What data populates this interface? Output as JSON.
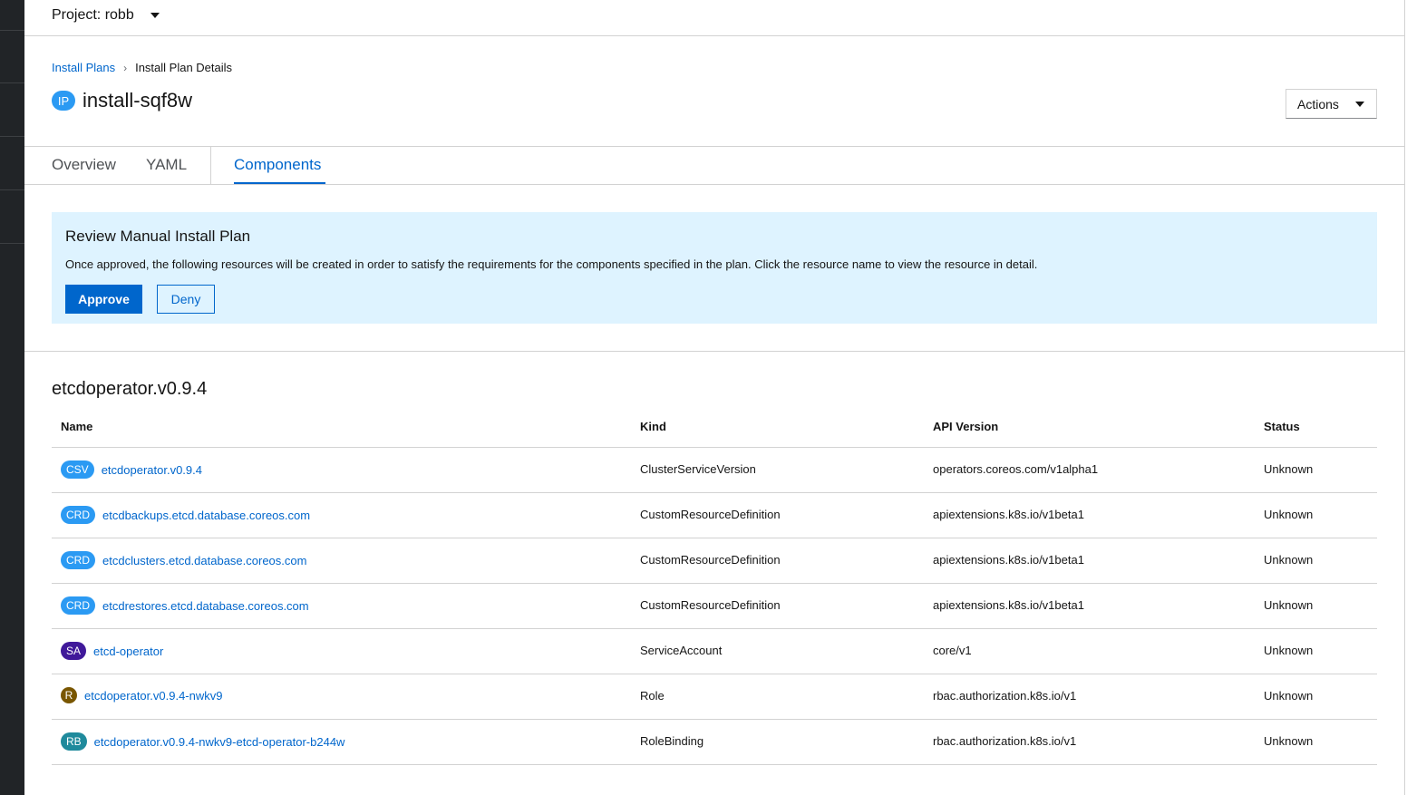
{
  "project": {
    "label": "Project: robb"
  },
  "breadcrumb": {
    "parent": "Install Plans",
    "current": "Install Plan Details"
  },
  "header": {
    "badge": "IP",
    "title": "install-sqf8w",
    "actions_label": "Actions"
  },
  "tabs": [
    {
      "label": "Overview"
    },
    {
      "label": "YAML"
    },
    {
      "label": "Components"
    }
  ],
  "alert": {
    "title": "Review Manual Install Plan",
    "text": "Once approved, the following resources will be created in order to satisfy the requirements for the components specified in the plan. Click the resource name to view the resource in detail.",
    "approve_label": "Approve",
    "deny_label": "Deny"
  },
  "section": {
    "title": "etcdoperator.v0.9.4"
  },
  "table": {
    "headers": {
      "name": "Name",
      "kind": "Kind",
      "api": "API Version",
      "status": "Status"
    },
    "rows": [
      {
        "badge": "CSV",
        "name": "etcdoperator.v0.9.4",
        "kind": "ClusterServiceVersion",
        "api": "operators.coreos.com/v1alpha1",
        "status": "Unknown"
      },
      {
        "badge": "CRD",
        "name": "etcdbackups.etcd.database.coreos.com",
        "kind": "CustomResourceDefinition",
        "api": "apiextensions.k8s.io/v1beta1",
        "status": "Unknown"
      },
      {
        "badge": "CRD",
        "name": "etcdclusters.etcd.database.coreos.com",
        "kind": "CustomResourceDefinition",
        "api": "apiextensions.k8s.io/v1beta1",
        "status": "Unknown"
      },
      {
        "badge": "CRD",
        "name": "etcdrestores.etcd.database.coreos.com",
        "kind": "CustomResourceDefinition",
        "api": "apiextensions.k8s.io/v1beta1",
        "status": "Unknown"
      },
      {
        "badge": "SA",
        "name": "etcd-operator",
        "kind": "ServiceAccount",
        "api": "core/v1",
        "status": "Unknown"
      },
      {
        "badge": "R",
        "name": "etcdoperator.v0.9.4-nwkv9",
        "kind": "Role",
        "api": "rbac.authorization.k8s.io/v1",
        "status": "Unknown"
      },
      {
        "badge": "RB",
        "name": "etcdoperator.v0.9.4-nwkv9-etcd-operator-b244w",
        "kind": "RoleBinding",
        "api": "rbac.authorization.k8s.io/v1",
        "status": "Unknown"
      }
    ]
  },
  "colors": {
    "link": "#0066cc",
    "alert_bg": "#def3ff",
    "nav_bg": "#212427",
    "badge_blue": "#2b9af3",
    "badge_sa": "#40199a",
    "badge_role": "#795600",
    "badge_rolebinding": "#1f8a9c"
  },
  "icons": {
    "project_caret": "caret-down-icon",
    "actions_caret": "caret-down-icon",
    "breadcrumb_sep": "chevron-right-icon"
  }
}
